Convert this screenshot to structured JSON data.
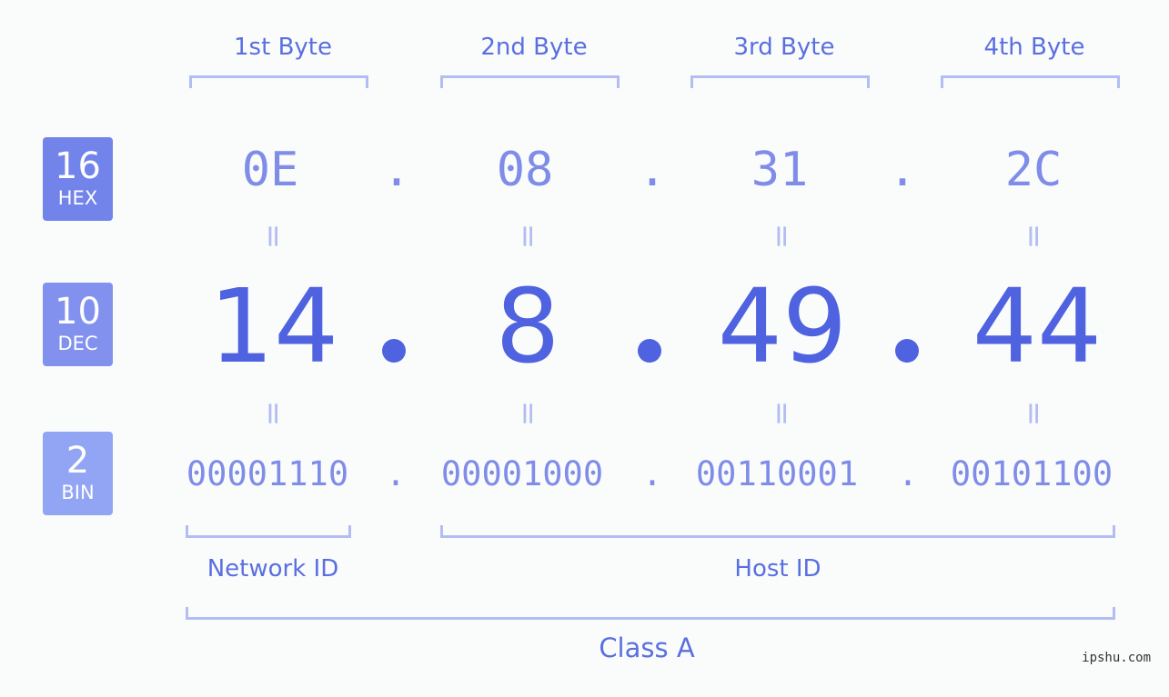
{
  "rows": {
    "hex": {
      "base": "16",
      "label": "HEX",
      "color": "#7283ea"
    },
    "dec": {
      "base": "10",
      "label": "DEC",
      "color": "#8291ee"
    },
    "bin": {
      "base": "2",
      "label": "BIN",
      "color": "#92a5f4"
    }
  },
  "bytes": [
    {
      "label": "1st Byte",
      "hex": "0E",
      "dec": "14",
      "bin": "00001110"
    },
    {
      "label": "2nd Byte",
      "hex": "08",
      "dec": "8",
      "bin": "00001000"
    },
    {
      "label": "3rd Byte",
      "hex": "31",
      "dec": "49",
      "bin": "00110001"
    },
    {
      "label": "4th Byte",
      "hex": "2C",
      "dec": "44",
      "bin": "00101100"
    }
  ],
  "separator": ".",
  "equals": "=",
  "segments": {
    "network": "Network ID",
    "host": "Host ID",
    "class": "Class A"
  },
  "watermark": "ipshu.com"
}
